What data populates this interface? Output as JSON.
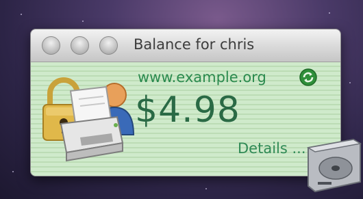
{
  "window": {
    "title": "Balance for chris",
    "site": "www.example.org",
    "balance": "$4.98",
    "details_link": "Details ..."
  },
  "icons": {
    "traffic_lights": [
      "close-button-icon",
      "minimize-button-icon",
      "zoom-button-icon"
    ],
    "app_icon": "lock-printer-user-icon",
    "refresh_icon": "refresh-icon",
    "desktop_icon": "hard-drive-icon"
  },
  "colors": {
    "content_bg": "#c9e6c2",
    "site_text": "#2a8a4e",
    "balance_text": "#2a6a45",
    "details_text": "#2f8a55"
  }
}
